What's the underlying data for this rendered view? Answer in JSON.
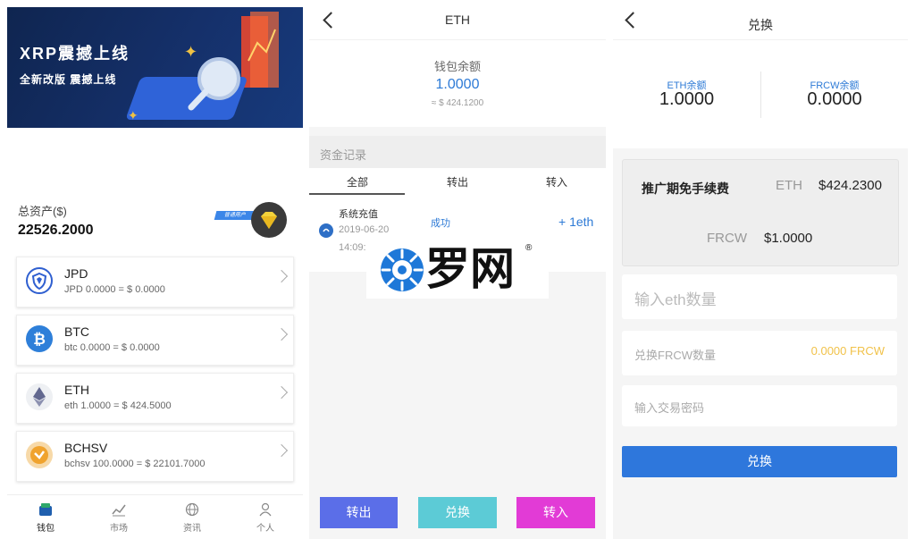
{
  "wallet": {
    "banner": {
      "title": "XRP震撼上线",
      "subtitle": "全新改版 震撼上线"
    },
    "total_assets": {
      "label": "总资产($)",
      "value": "22526.2000"
    },
    "tag": "普通用户",
    "coins": [
      {
        "name": "JPD",
        "detail": "JPD 0.0000 = $ 0.0000",
        "icon_color": "#2f5fd0",
        "icon": "shield-icon"
      },
      {
        "name": "BTC",
        "detail": "btc 0.0000 = $ 0.0000",
        "icon_color": "#2e7fd9",
        "icon": "bitcoin-icon"
      },
      {
        "name": "ETH",
        "detail": "eth 1.0000 = $ 424.5000",
        "icon_color": "#8a8f98",
        "icon": "ethereum-icon"
      },
      {
        "name": "BCHSV",
        "detail": "bchsv 100.0000 = $ 22101.7000",
        "icon_color": "#f0b24a",
        "icon": "bchsv-icon"
      }
    ],
    "nav": [
      {
        "label": "钱包",
        "icon": "wallet-icon"
      },
      {
        "label": "市场",
        "icon": "chart-icon"
      },
      {
        "label": "资讯",
        "icon": "globe-icon"
      },
      {
        "label": "个人",
        "icon": "user-icon"
      }
    ]
  },
  "eth_detail": {
    "title": "ETH",
    "balance_label": "钱包余额",
    "balance_value": "1.0000",
    "balance_usd": "≈ $ 424.1200",
    "records_title": "资金记录",
    "tabs": [
      "全部",
      "转出",
      "转入"
    ],
    "record": {
      "type": "系统充值",
      "date": "2019-06-20",
      "time": "14:09:",
      "status": "成功",
      "amount": "+ 1eth"
    },
    "buttons": [
      {
        "label": "转出",
        "color": "#5b6ee8"
      },
      {
        "label": "兑换",
        "color": "#5ccbd6"
      },
      {
        "label": "转入",
        "color": "#e23bd6"
      }
    ],
    "watermark": "罗网"
  },
  "swap": {
    "title": "兑换",
    "eth_balance_label": "ETH余额",
    "eth_balance": "1.0000",
    "frcw_balance_label": "FRCW余额",
    "frcw_balance": "0.0000",
    "promo_label": "推广期免手续费",
    "eth_label": "ETH",
    "eth_price": "$424.2300",
    "frcw_label": "FRCW",
    "frcw_price": "$1.0000",
    "eth_input_placeholder": "输入eth数量",
    "frcw_amount_label": "兑换FRCW数量",
    "frcw_amount_value": "0.0000 FRCW",
    "password_placeholder": "输入交易密码",
    "button": "兑换"
  }
}
